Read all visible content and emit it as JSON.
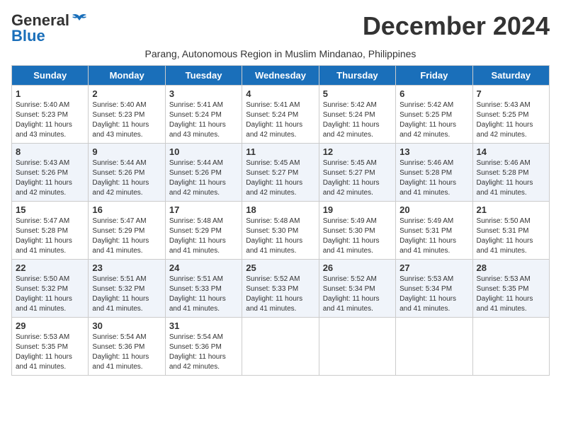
{
  "header": {
    "logo_general": "General",
    "logo_blue": "Blue",
    "month_title": "December 2024",
    "subtitle": "Parang, Autonomous Region in Muslim Mindanao, Philippines"
  },
  "weekdays": [
    "Sunday",
    "Monday",
    "Tuesday",
    "Wednesday",
    "Thursday",
    "Friday",
    "Saturday"
  ],
  "weeks": [
    [
      {
        "day": "1",
        "sunrise": "Sunrise: 5:40 AM",
        "sunset": "Sunset: 5:23 PM",
        "daylight": "Daylight: 11 hours and 43 minutes."
      },
      {
        "day": "2",
        "sunrise": "Sunrise: 5:40 AM",
        "sunset": "Sunset: 5:23 PM",
        "daylight": "Daylight: 11 hours and 43 minutes."
      },
      {
        "day": "3",
        "sunrise": "Sunrise: 5:41 AM",
        "sunset": "Sunset: 5:24 PM",
        "daylight": "Daylight: 11 hours and 43 minutes."
      },
      {
        "day": "4",
        "sunrise": "Sunrise: 5:41 AM",
        "sunset": "Sunset: 5:24 PM",
        "daylight": "Daylight: 11 hours and 42 minutes."
      },
      {
        "day": "5",
        "sunrise": "Sunrise: 5:42 AM",
        "sunset": "Sunset: 5:24 PM",
        "daylight": "Daylight: 11 hours and 42 minutes."
      },
      {
        "day": "6",
        "sunrise": "Sunrise: 5:42 AM",
        "sunset": "Sunset: 5:25 PM",
        "daylight": "Daylight: 11 hours and 42 minutes."
      },
      {
        "day": "7",
        "sunrise": "Sunrise: 5:43 AM",
        "sunset": "Sunset: 5:25 PM",
        "daylight": "Daylight: 11 hours and 42 minutes."
      }
    ],
    [
      {
        "day": "8",
        "sunrise": "Sunrise: 5:43 AM",
        "sunset": "Sunset: 5:26 PM",
        "daylight": "Daylight: 11 hours and 42 minutes."
      },
      {
        "day": "9",
        "sunrise": "Sunrise: 5:44 AM",
        "sunset": "Sunset: 5:26 PM",
        "daylight": "Daylight: 11 hours and 42 minutes."
      },
      {
        "day": "10",
        "sunrise": "Sunrise: 5:44 AM",
        "sunset": "Sunset: 5:26 PM",
        "daylight": "Daylight: 11 hours and 42 minutes."
      },
      {
        "day": "11",
        "sunrise": "Sunrise: 5:45 AM",
        "sunset": "Sunset: 5:27 PM",
        "daylight": "Daylight: 11 hours and 42 minutes."
      },
      {
        "day": "12",
        "sunrise": "Sunrise: 5:45 AM",
        "sunset": "Sunset: 5:27 PM",
        "daylight": "Daylight: 11 hours and 42 minutes."
      },
      {
        "day": "13",
        "sunrise": "Sunrise: 5:46 AM",
        "sunset": "Sunset: 5:28 PM",
        "daylight": "Daylight: 11 hours and 41 minutes."
      },
      {
        "day": "14",
        "sunrise": "Sunrise: 5:46 AM",
        "sunset": "Sunset: 5:28 PM",
        "daylight": "Daylight: 11 hours and 41 minutes."
      }
    ],
    [
      {
        "day": "15",
        "sunrise": "Sunrise: 5:47 AM",
        "sunset": "Sunset: 5:28 PM",
        "daylight": "Daylight: 11 hours and 41 minutes."
      },
      {
        "day": "16",
        "sunrise": "Sunrise: 5:47 AM",
        "sunset": "Sunset: 5:29 PM",
        "daylight": "Daylight: 11 hours and 41 minutes."
      },
      {
        "day": "17",
        "sunrise": "Sunrise: 5:48 AM",
        "sunset": "Sunset: 5:29 PM",
        "daylight": "Daylight: 11 hours and 41 minutes."
      },
      {
        "day": "18",
        "sunrise": "Sunrise: 5:48 AM",
        "sunset": "Sunset: 5:30 PM",
        "daylight": "Daylight: 11 hours and 41 minutes."
      },
      {
        "day": "19",
        "sunrise": "Sunrise: 5:49 AM",
        "sunset": "Sunset: 5:30 PM",
        "daylight": "Daylight: 11 hours and 41 minutes."
      },
      {
        "day": "20",
        "sunrise": "Sunrise: 5:49 AM",
        "sunset": "Sunset: 5:31 PM",
        "daylight": "Daylight: 11 hours and 41 minutes."
      },
      {
        "day": "21",
        "sunrise": "Sunrise: 5:50 AM",
        "sunset": "Sunset: 5:31 PM",
        "daylight": "Daylight: 11 hours and 41 minutes."
      }
    ],
    [
      {
        "day": "22",
        "sunrise": "Sunrise: 5:50 AM",
        "sunset": "Sunset: 5:32 PM",
        "daylight": "Daylight: 11 hours and 41 minutes."
      },
      {
        "day": "23",
        "sunrise": "Sunrise: 5:51 AM",
        "sunset": "Sunset: 5:32 PM",
        "daylight": "Daylight: 11 hours and 41 minutes."
      },
      {
        "day": "24",
        "sunrise": "Sunrise: 5:51 AM",
        "sunset": "Sunset: 5:33 PM",
        "daylight": "Daylight: 11 hours and 41 minutes."
      },
      {
        "day": "25",
        "sunrise": "Sunrise: 5:52 AM",
        "sunset": "Sunset: 5:33 PM",
        "daylight": "Daylight: 11 hours and 41 minutes."
      },
      {
        "day": "26",
        "sunrise": "Sunrise: 5:52 AM",
        "sunset": "Sunset: 5:34 PM",
        "daylight": "Daylight: 11 hours and 41 minutes."
      },
      {
        "day": "27",
        "sunrise": "Sunrise: 5:53 AM",
        "sunset": "Sunset: 5:34 PM",
        "daylight": "Daylight: 11 hours and 41 minutes."
      },
      {
        "day": "28",
        "sunrise": "Sunrise: 5:53 AM",
        "sunset": "Sunset: 5:35 PM",
        "daylight": "Daylight: 11 hours and 41 minutes."
      }
    ],
    [
      {
        "day": "29",
        "sunrise": "Sunrise: 5:53 AM",
        "sunset": "Sunset: 5:35 PM",
        "daylight": "Daylight: 11 hours and 41 minutes."
      },
      {
        "day": "30",
        "sunrise": "Sunrise: 5:54 AM",
        "sunset": "Sunset: 5:36 PM",
        "daylight": "Daylight: 11 hours and 41 minutes."
      },
      {
        "day": "31",
        "sunrise": "Sunrise: 5:54 AM",
        "sunset": "Sunset: 5:36 PM",
        "daylight": "Daylight: 11 hours and 42 minutes."
      },
      null,
      null,
      null,
      null
    ]
  ]
}
